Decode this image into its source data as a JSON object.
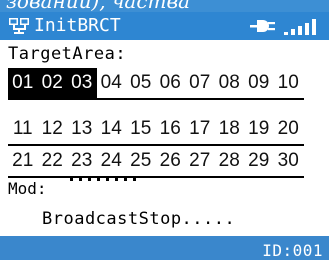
{
  "top_fragment": "зований), частва",
  "titlebar": {
    "title": "InitBRCT",
    "icons": {
      "app": "network-icon",
      "connection": "plug-icon",
      "signal": "signal-strength-icon"
    }
  },
  "target_area": {
    "label": "TargetArea:",
    "rows": [
      [
        "01",
        "02",
        "03",
        "04",
        "05",
        "06",
        "07",
        "08",
        "09",
        "10"
      ],
      [
        "11",
        "12",
        "13",
        "14",
        "15",
        "16",
        "17",
        "18",
        "19",
        "20"
      ],
      [
        "21",
        "22",
        "23",
        "24",
        "25",
        "26",
        "27",
        "28",
        "29",
        "30"
      ]
    ],
    "selected": [
      "01",
      "02",
      "03"
    ]
  },
  "mod": {
    "label": "Mod:"
  },
  "status": {
    "text": "BroadcastStop....."
  },
  "footer": {
    "id_text": "ID:001"
  },
  "colors": {
    "bar_blue": "#2e86d2",
    "selected_bg": "#000000"
  }
}
